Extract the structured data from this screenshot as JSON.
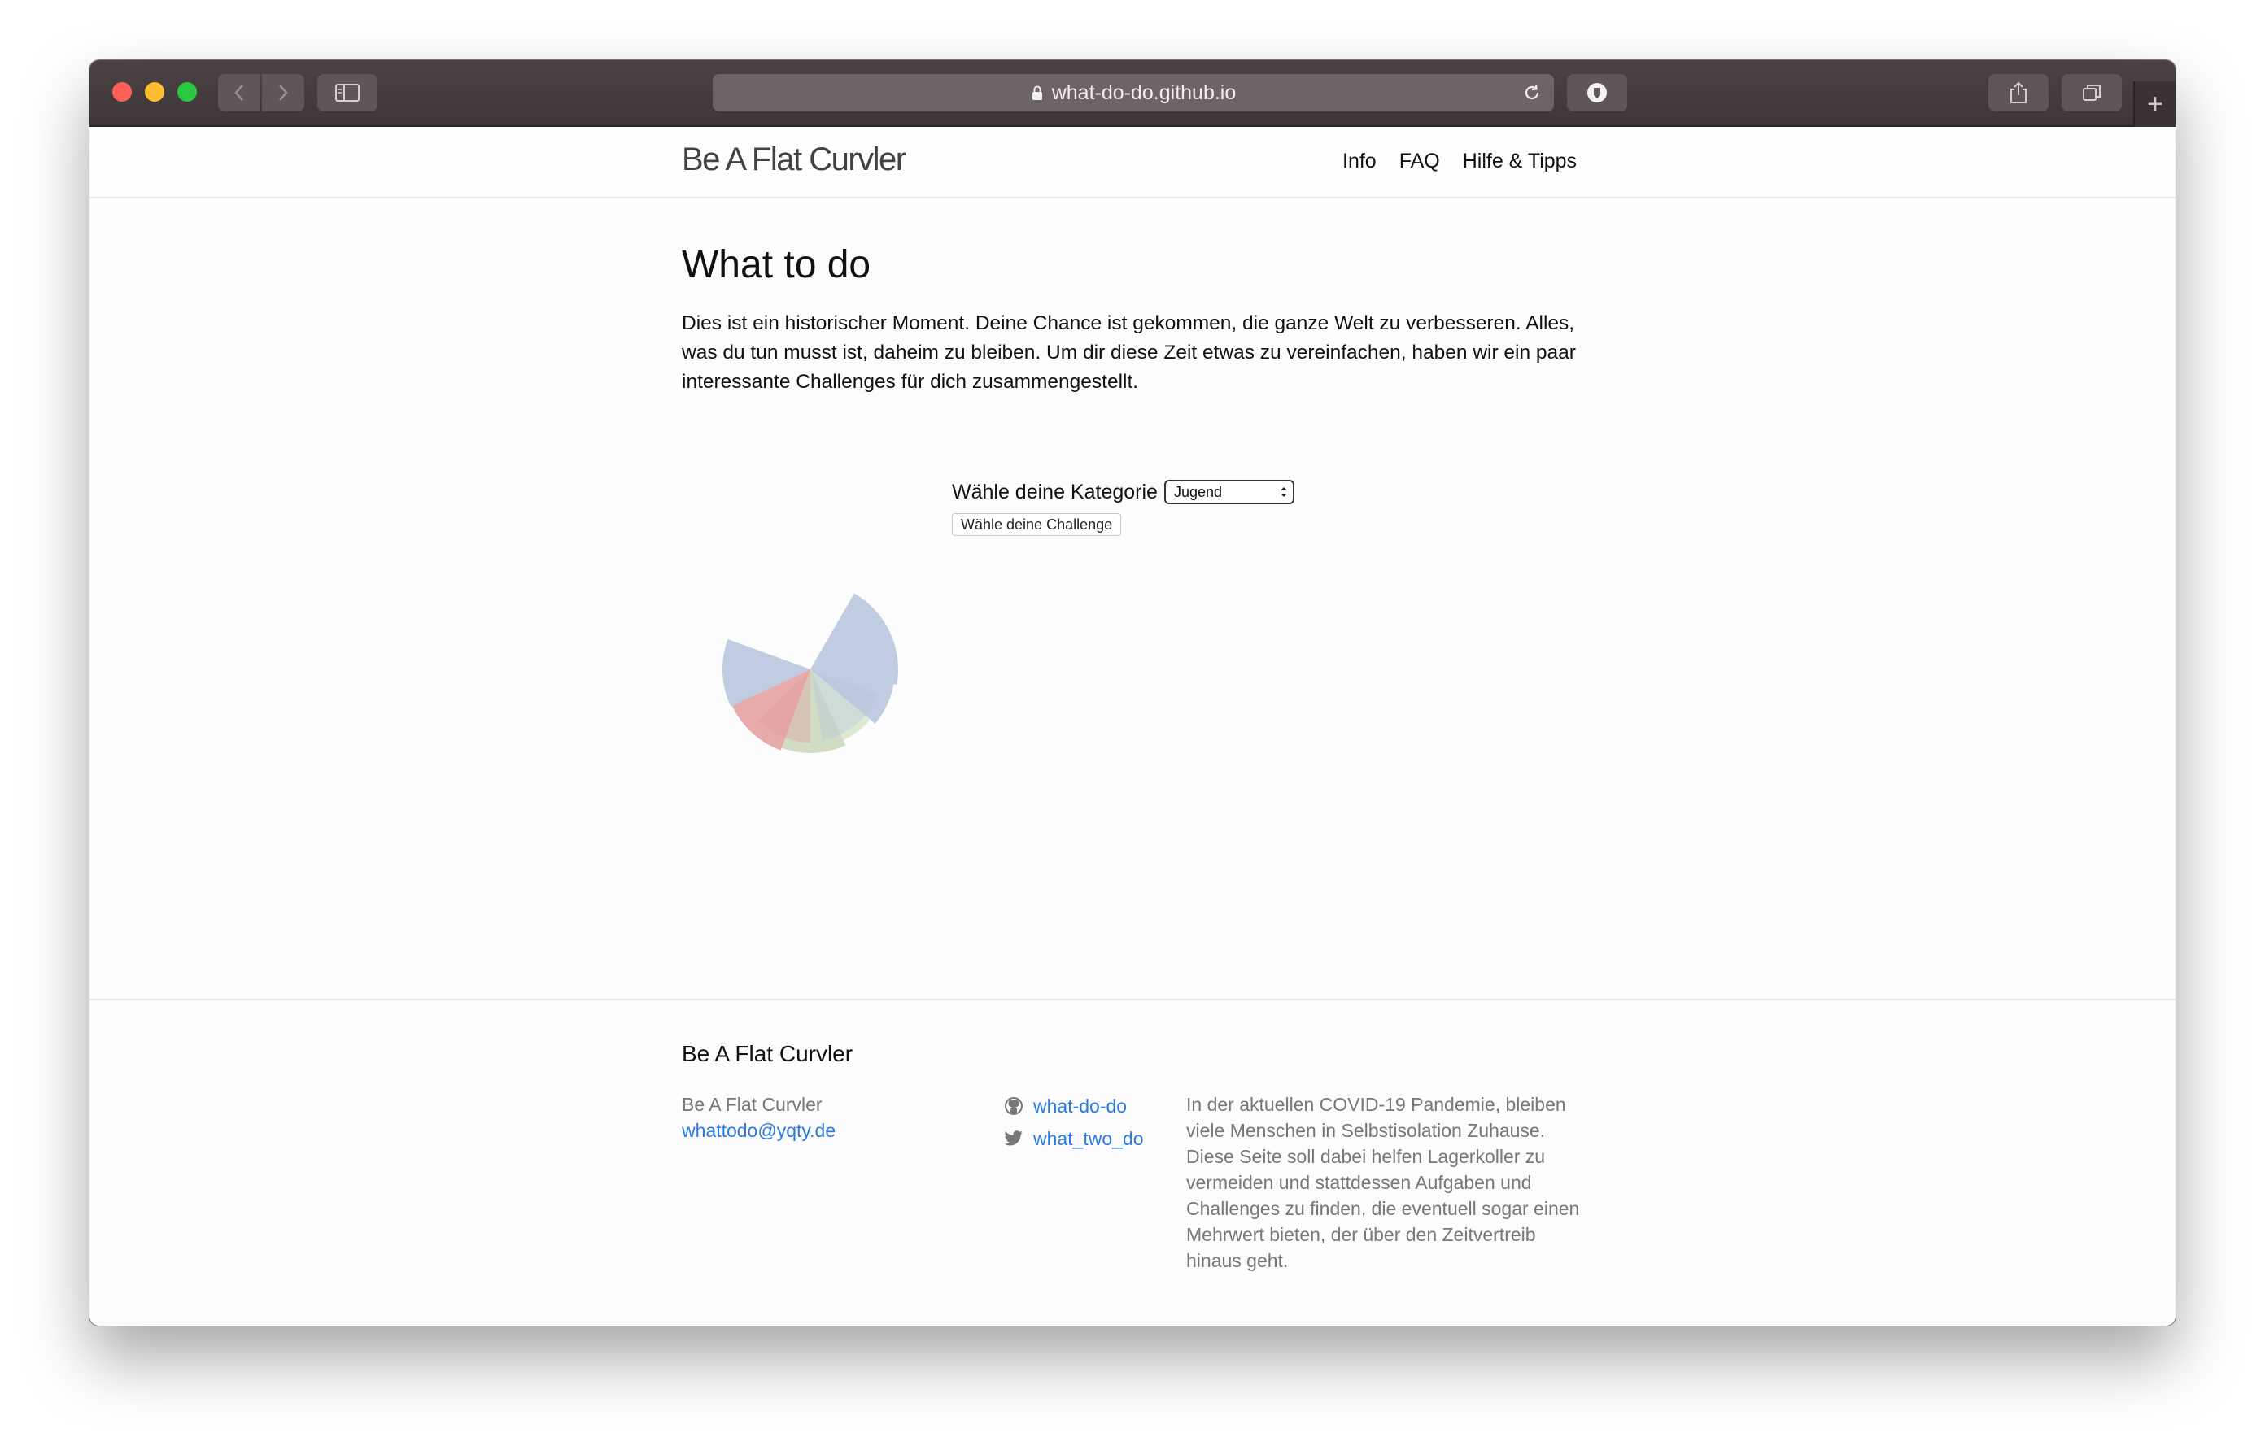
{
  "browser": {
    "url": "what-do-do.github.io"
  },
  "header": {
    "site_title": "Be A Flat Curvler",
    "nav": [
      "Info",
      "FAQ",
      "Hilfe & Tipps"
    ]
  },
  "main": {
    "heading": "What to do",
    "intro": "Dies ist ein historischer Moment. Deine Chance ist gekommen, die ganze Welt zu verbesseren. Alles, was du tun musst ist, daheim zu bleiben. Um dir diese Zeit etwas zu vereinfachen, haben wir ein paar interessante Challenges für dich zusammengestellt.",
    "category_label": "Wähle deine Kategorie",
    "category_selected": "Jugend",
    "challenge_button": "Wähle deine Challenge"
  },
  "wheel": {
    "colors": {
      "blue": "#b4c3dc",
      "red": "#e39c9c",
      "green": "#c8d6b8",
      "light_green": "#d6e6cc"
    }
  },
  "footer": {
    "title": "Be A Flat Curvler",
    "name": "Be A Flat Curvler",
    "email": "whattodo@yqty.de",
    "github": "what-do-do",
    "twitter": "what_two_do",
    "description": "In der aktuellen COVID-19 Pandemie, bleiben viele Menschen in Selbstisolation Zuhause. Diese Seite soll dabei helfen Lagerkoller zu vermeiden und stattdessen Aufgaben und Challenges zu finden, die eventuell sogar einen Mehrwert bieten, der über den Zeitvertreib hinaus geht."
  }
}
